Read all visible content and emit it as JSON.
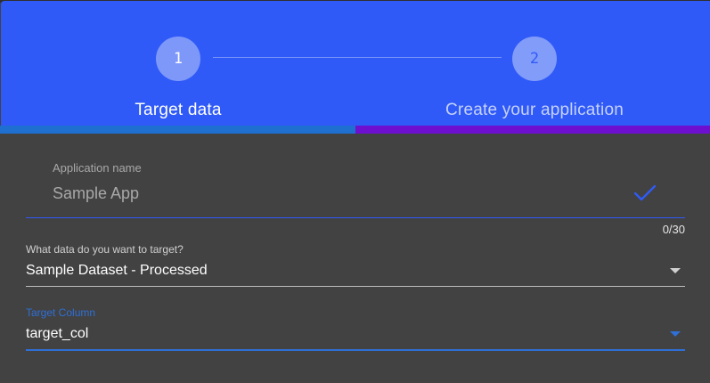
{
  "stepper": {
    "steps": [
      {
        "number": "1",
        "label": "Target data"
      },
      {
        "number": "2",
        "label": "Create your application"
      }
    ],
    "progress_fraction": 0.5
  },
  "form": {
    "app_name": {
      "label": "Application name",
      "placeholder": "Sample App",
      "counter": "0/30"
    },
    "target_data": {
      "label": "What data do you want to target?",
      "value": "Sample Dataset - Processed"
    },
    "target_column": {
      "label": "Target Column",
      "value": "target_col"
    }
  },
  "colors": {
    "header": "#2f5af7",
    "progress_fill": "#1f6fd1",
    "progress_track": "#6e0fcf",
    "background": "#424242",
    "focus": "#2f6fd6"
  },
  "icons": {
    "check": "check-icon",
    "dropdown": "chevron-down-icon"
  }
}
